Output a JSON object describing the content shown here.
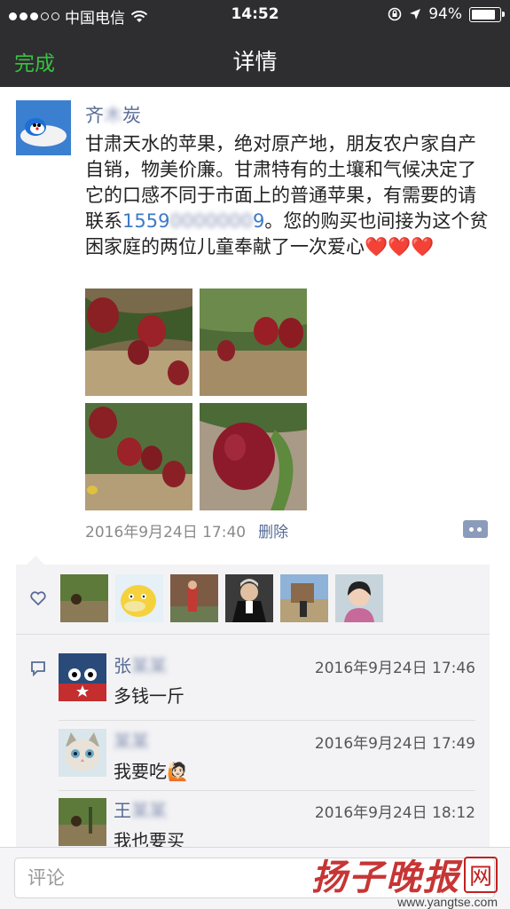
{
  "status_bar": {
    "carrier": "中国电信",
    "time": "14:52",
    "battery": "94%",
    "battery_level": 0.94
  },
  "nav": {
    "back_label": "完成",
    "title": "详情"
  },
  "post": {
    "author": "齐",
    "author_blur": "木",
    "author_suffix": "炭",
    "text_before_phone": "甘肃天水的苹果，绝对原产地，朋友农户家自产自销，物美价廉。甘肃特有的土壤和气候决定了它的口感不同于市面上的普通苹果，有需要的请联系",
    "phone_visible": "1559",
    "phone_blur": "0000000",
    "phone_tail": "9",
    "text_after_phone": "。您的购买也间接为这个贫困家庭的两位儿童奉献了一次爱心",
    "hearts": "❤️❤️❤️",
    "timestamp": "2016年9月24日 17:40",
    "delete_label": "删除"
  },
  "comments": [
    {
      "name_visible": "张",
      "name_blur": "某某",
      "time": "2016年9月24日 17:46",
      "text": "多钱一斤"
    },
    {
      "name_visible": "",
      "name_blur": "某某",
      "time": "2016年9月24日 17:49",
      "text": "我要吃🙋🏻"
    },
    {
      "name_visible": "王",
      "name_blur": "某某",
      "time": "2016年9月24日 18:12",
      "text": "我也要买"
    }
  ],
  "comment_input": {
    "placeholder": "评论"
  },
  "watermark": {
    "name": "扬子晚报",
    "box": "网",
    "url": "www.yangtse.com"
  }
}
